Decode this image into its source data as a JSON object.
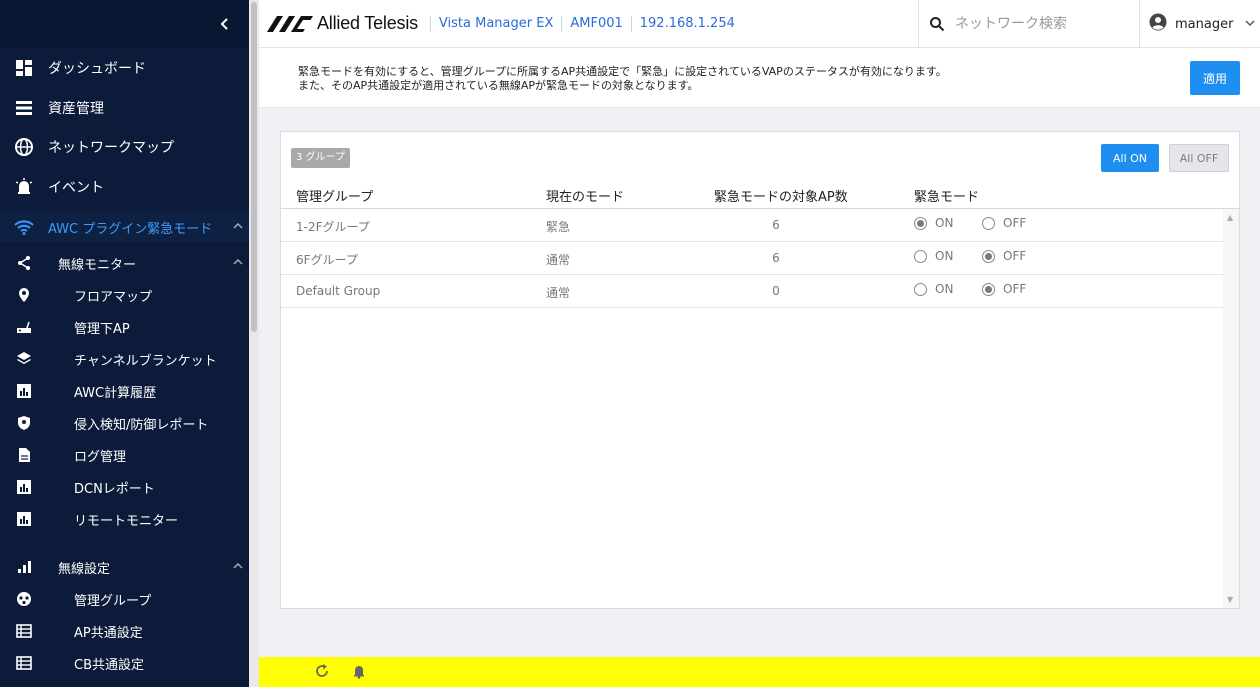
{
  "sidebar": {
    "items": [
      {
        "label": "ダッシュボード",
        "icon": "dashboard-icon"
      },
      {
        "label": "資産管理",
        "icon": "list-icon"
      },
      {
        "label": "ネットワークマップ",
        "icon": "globe-icon"
      },
      {
        "label": "イベント",
        "icon": "alarm-icon"
      },
      {
        "label": "AWC プラグイン緊急モード",
        "icon": "wifi-icon",
        "active": true
      },
      {
        "label": "無線モニター",
        "icon": "share-icon"
      },
      {
        "label": "フロアマップ",
        "icon": "pin-icon"
      },
      {
        "label": "管理下AP",
        "icon": "router-icon"
      },
      {
        "label": "チャンネルブランケット",
        "icon": "layers-icon"
      },
      {
        "label": "AWC計算履歴",
        "icon": "chart-icon"
      },
      {
        "label": "侵入検知/防御レポート",
        "icon": "shield-icon"
      },
      {
        "label": "ログ管理",
        "icon": "document-icon"
      },
      {
        "label": "DCNレポート",
        "icon": "chart-icon"
      },
      {
        "label": "リモートモニター",
        "icon": "chart-icon"
      },
      {
        "label": "無線設定",
        "icon": "signal-icon"
      },
      {
        "label": "管理グループ",
        "icon": "group-icon"
      },
      {
        "label": "AP共通設定",
        "icon": "table-icon"
      },
      {
        "label": "CB共通設定",
        "icon": "table-icon"
      }
    ]
  },
  "header": {
    "brand": "Allied Telesis",
    "product": "Vista Manager EX",
    "device": "AMF001",
    "ip": "192.168.1.254",
    "search_placeholder": "ネットワーク検索",
    "user": "manager"
  },
  "info": {
    "line1": "緊急モードを有効にすると、管理グループに所属するAP共通設定で「緊急」に設定されているVAPのステータスが有効になります。",
    "line2": "また、そのAP共通設定が適用されている無線APが緊急モードの対象となります。",
    "apply_label": "適用"
  },
  "panel": {
    "group_count": "3 グループ",
    "all_on_label": "All ON",
    "all_off_label": "All OFF",
    "columns": [
      "管理グループ",
      "現在のモード",
      "緊急モードの対象AP数",
      "緊急モード"
    ],
    "on_label": "ON",
    "off_label": "OFF",
    "rows": [
      {
        "name": "1-2Fグループ",
        "mode": "緊急",
        "count": "6",
        "emergency": "ON"
      },
      {
        "name": "6Fグループ",
        "mode": "通常",
        "count": "6",
        "emergency": "OFF"
      },
      {
        "name": "Default Group",
        "mode": "通常",
        "count": "0",
        "emergency": "OFF"
      }
    ]
  },
  "colors": {
    "sidebar_bg": "#0c1b3a",
    "accent": "#1e8ef0",
    "bottom_bar": "#ffff00"
  }
}
